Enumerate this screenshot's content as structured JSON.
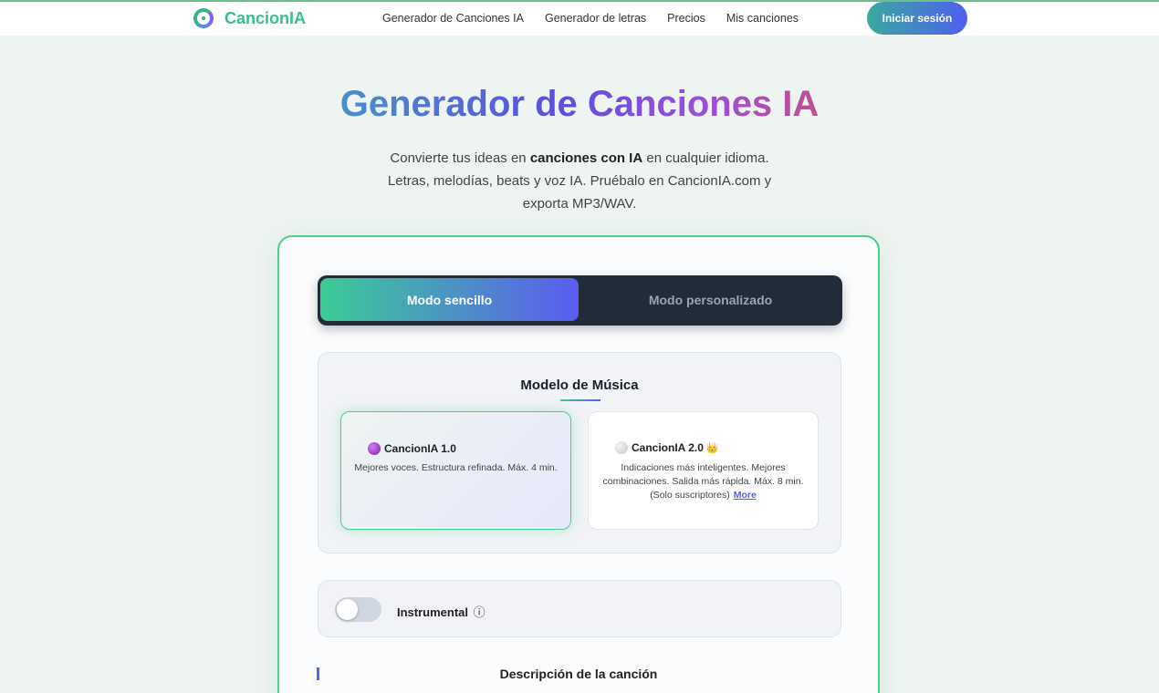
{
  "header": {
    "brand": "CancionIA",
    "nav": [
      {
        "label": "Generador de Canciones IA"
      },
      {
        "label": "Generador de letras"
      },
      {
        "label": "Precios"
      },
      {
        "label": "Mis canciones"
      }
    ],
    "login_label": "Iniciar sesión"
  },
  "hero": {
    "title": "Generador de Canciones IA",
    "subtitle_pre": "Convierte tus ideas en ",
    "subtitle_bold": "canciones con IA",
    "subtitle_post": " en cualquier idioma. Letras, melodías, beats y voz IA. Pruébalo en CancionIA.com y exporta MP3/WAV."
  },
  "modes": {
    "simple": "Modo sencillo",
    "custom": "Modo personalizado",
    "active": "simple"
  },
  "model_section": {
    "title": "Modelo de Música",
    "models": [
      {
        "name": "CancionIA 1.0",
        "icon": "purple-circle-icon",
        "description": "Mejores voces. Estructura refinada. Máx. 4 min.",
        "selected": true
      },
      {
        "name": "CancionIA 2.0",
        "icon": "grey-circle-icon",
        "badge": "👑",
        "description": "Indicaciones más inteligentes. Mejores combinaciones. Salida más rápida. Máx. 8 min. (Solo suscriptores)",
        "more": "More",
        "selected": false
      }
    ]
  },
  "instrumental": {
    "label": "Instrumental",
    "info_icon": "ⓘ",
    "enabled": false
  },
  "description_section": {
    "title": "Descripción de la canción"
  },
  "colors": {
    "accent_green": "#3ccc96",
    "accent_blue": "#5b5cf0",
    "brand_green": "#36c08a"
  }
}
